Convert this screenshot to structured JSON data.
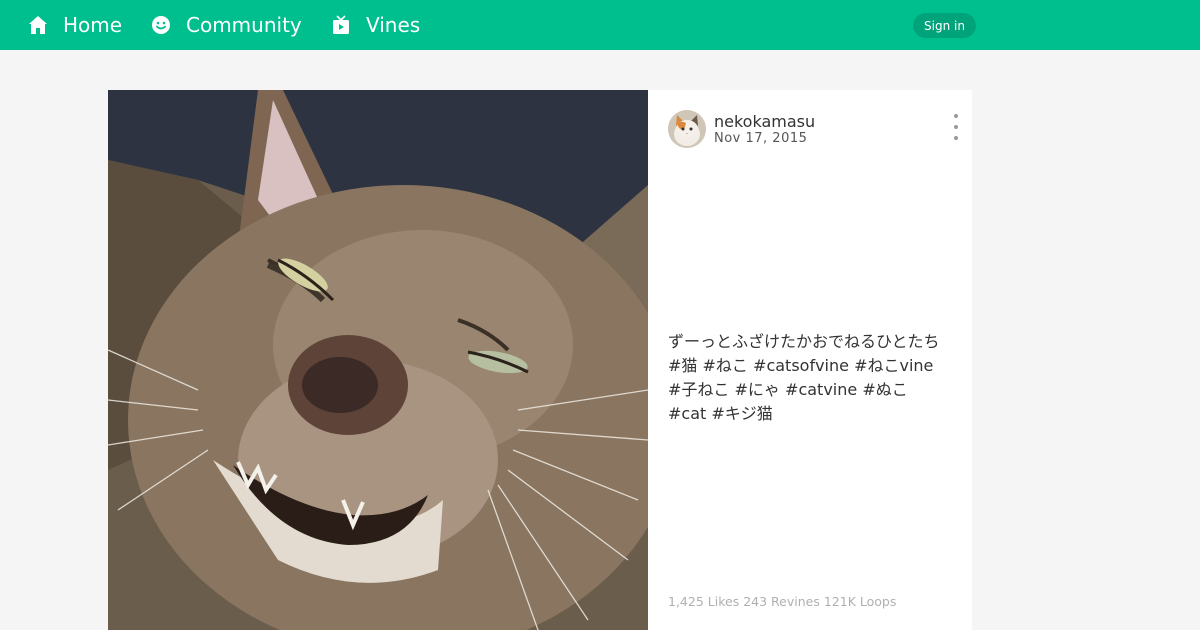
{
  "nav": {
    "home_label": "Home",
    "community_label": "Community",
    "vines_label": "Vines",
    "signin_label": "Sign in"
  },
  "post": {
    "username": "nekokamasu",
    "date": "Nov 17, 2015",
    "caption_text": "ずーっとふざけたかおでねるひとたち",
    "hashtags": [
      "#猫",
      "#ねこ",
      "#catsofvine",
      "#ねこvine",
      "#子ねこ",
      "#にゃ",
      "#catvine",
      "#ぬこ",
      "#cat",
      "#キジ猫"
    ],
    "likes": "1,425",
    "likes_label": "Likes",
    "revines": "243",
    "revines_label": "Revines",
    "loops": "121K",
    "loops_label": "Loops"
  },
  "icons": {
    "home": "home-icon",
    "community": "smiley-icon",
    "vines": "tv-icon",
    "more": "more-vertical-icon"
  },
  "colors": {
    "brand": "#00bf8f",
    "signin_bg": "#00a37a",
    "page_bg": "#f5f5f5"
  }
}
